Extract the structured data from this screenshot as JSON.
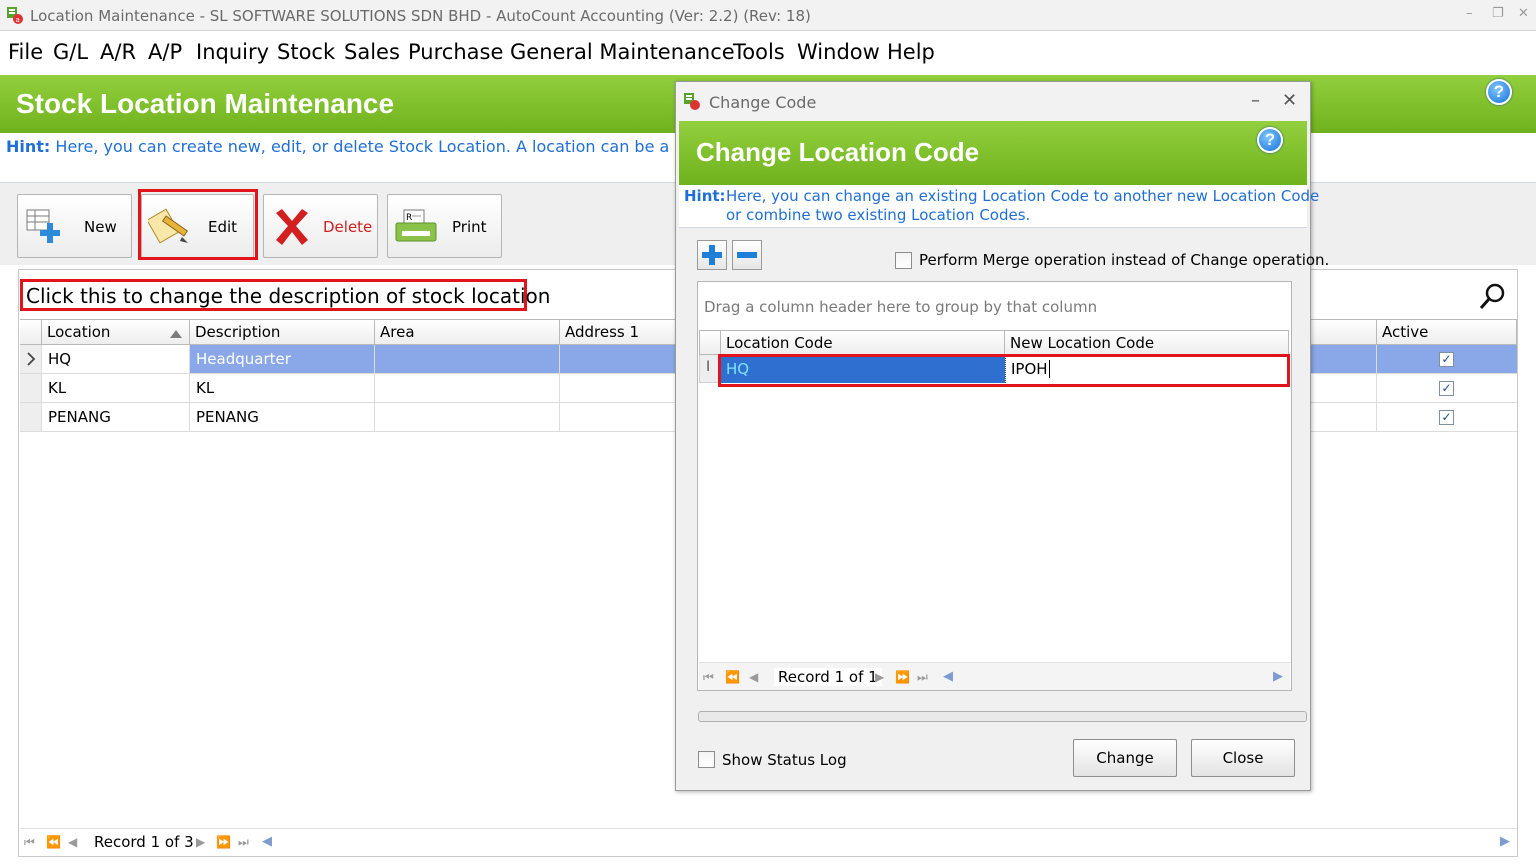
{
  "window": {
    "title": "Location Maintenance - SL SOFTWARE SOLUTIONS SDN BHD - AutoCount Accounting (Ver: 2.2) (Rev: 18)",
    "controls": [
      "–",
      "❐",
      "✕"
    ]
  },
  "menu": [
    "File",
    "G/L",
    "A/R",
    "A/P",
    "Inquiry",
    "Stock",
    "Sales",
    "Purchase",
    "General Maintenance",
    "Tools",
    "Window",
    "Help"
  ],
  "header": {
    "title": "Stock Location Maintenance",
    "hint_label": "Hint:",
    "hint_text": "Here, you can create new, edit, or delete Stock Location. A location can be a place to st"
  },
  "toolbar": {
    "new": "New",
    "edit": "Edit",
    "delete": "Delete",
    "print": "Print"
  },
  "annotation": "Click this to change the description of stock location",
  "grid": {
    "columns": [
      "Location",
      "Description",
      "Area",
      "Address 1",
      "Active"
    ],
    "rows": [
      {
        "location": "HQ",
        "description": "Headquarter",
        "active": true
      },
      {
        "location": "KL",
        "description": "KL",
        "active": true
      },
      {
        "location": "PENANG",
        "description": "PENANG",
        "active": true
      }
    ],
    "record_text": "Record 1 of 3"
  },
  "dialog": {
    "title": "Change Code",
    "heading": "Change Location Code",
    "hint_label": "Hint:",
    "hint_line1": "Here, you can change an existing Location Code to another new Location Code",
    "hint_line2": "or combine two existing Location Codes.",
    "merge_label": "Perform Merge operation instead of Change operation.",
    "group_hint": "Drag a column header here to group by that column",
    "columns": [
      "Location Code",
      "New Location Code"
    ],
    "row": {
      "location_code": "HQ",
      "new_location_code": "IPOH"
    },
    "record_text": "Record 1 of 1",
    "show_status_log": "Show Status Log",
    "change_button": "Change",
    "close_button": "Close"
  },
  "colors": {
    "green_header": "#7ec12c",
    "hint_blue": "#1f6fd6",
    "selected_row": "#8aa8e8",
    "dialog_selected_cell": "#2f6fcf",
    "highlight_red": "#e0141a"
  }
}
